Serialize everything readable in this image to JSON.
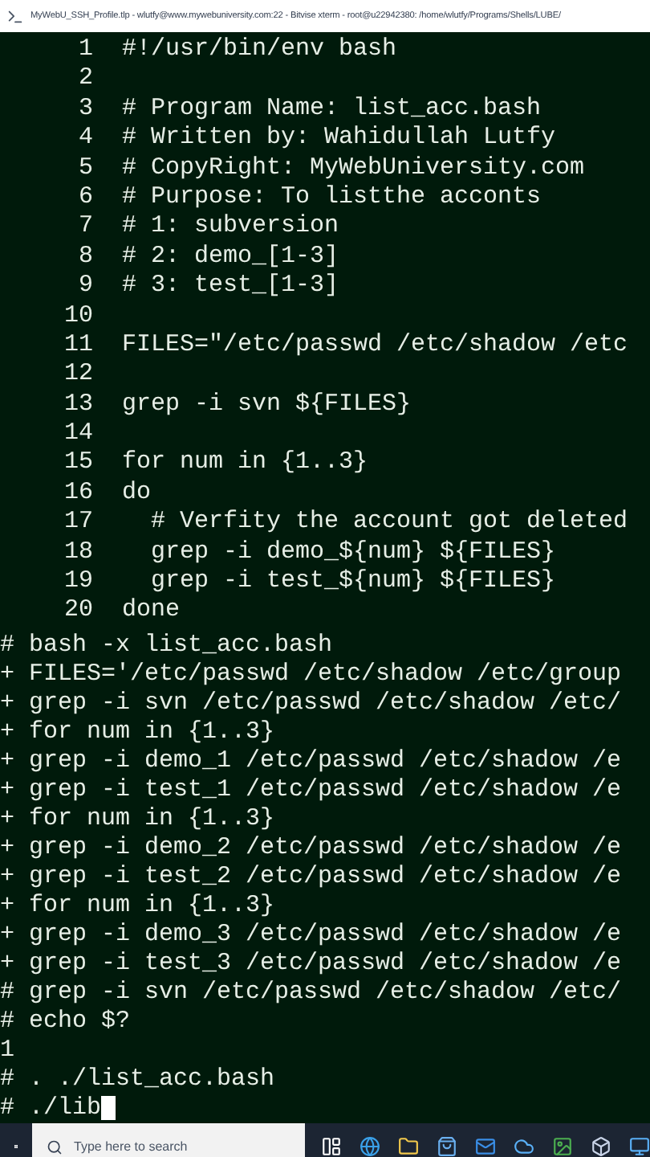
{
  "window": {
    "title": "MyWebU_SSH_Profile.tlp - wlutfy@www.mywebuniversity.com:22 - Bitvise xterm - root@u22942380: /home/wlutfy/Programs/Shells/LUBE/"
  },
  "editor_lines": [
    {
      "number": "1",
      "code": "#!/usr/bin/env bash"
    },
    {
      "number": "2"
    },
    {
      "number": "3",
      "code": "# Program Name: list_acc.bash"
    },
    {
      "number": "4",
      "code": "# Written by: Wahidullah Lutfy"
    },
    {
      "number": "5",
      "code": "# CopyRight: MyWebUniversity.com"
    },
    {
      "number": "6",
      "code": "# Purpose: To listthe acconts"
    },
    {
      "number": "7",
      "code": "# 1: subversion"
    },
    {
      "number": "8",
      "code": "# 2: demo_[1-3]"
    },
    {
      "number": "9",
      "code": "# 3: test_[1-3]"
    },
    {
      "number": "10"
    },
    {
      "number": "11",
      "code": "FILES=\"/etc/passwd /etc/shadow /etc"
    },
    {
      "number": "12"
    },
    {
      "number": "13",
      "code": "grep -i svn ${FILES}"
    },
    {
      "number": "14"
    },
    {
      "number": "15",
      "code": "for num in {1..3}"
    },
    {
      "number": "16",
      "code": "do"
    },
    {
      "number": "17",
      "code": "  # Verfity the account got deleted"
    },
    {
      "number": "18",
      "code": "  grep -i demo_${num} ${FILES}"
    },
    {
      "number": "19",
      "code": "  grep -i test_${num} ${FILES}"
    },
    {
      "number": "20",
      "code": "done"
    }
  ],
  "output_lines": [
    "# bash -x list_acc.bash",
    "+ FILES='/etc/passwd /etc/shadow /etc/group",
    "+ grep -i svn /etc/passwd /etc/shadow /etc/",
    "+ for num in {1..3}",
    "+ grep -i demo_1 /etc/passwd /etc/shadow /e",
    "+ grep -i test_1 /etc/passwd /etc/shadow /e",
    "+ for num in {1..3}",
    "+ grep -i demo_2 /etc/passwd /etc/shadow /e",
    "+ grep -i test_2 /etc/passwd /etc/shadow /e",
    "+ for num in {1..3}",
    "+ grep -i demo_3 /etc/passwd /etc/shadow /e",
    "+ grep -i test_3 /etc/passwd /etc/shadow /e",
    "# grep -i svn /etc/passwd /etc/shadow /etc/",
    "# echo $?",
    "1",
    "# . ./list_acc.bash",
    "# ./lib"
  ],
  "taskbar": {
    "search": {
      "placeholder": "Type here to search"
    }
  }
}
